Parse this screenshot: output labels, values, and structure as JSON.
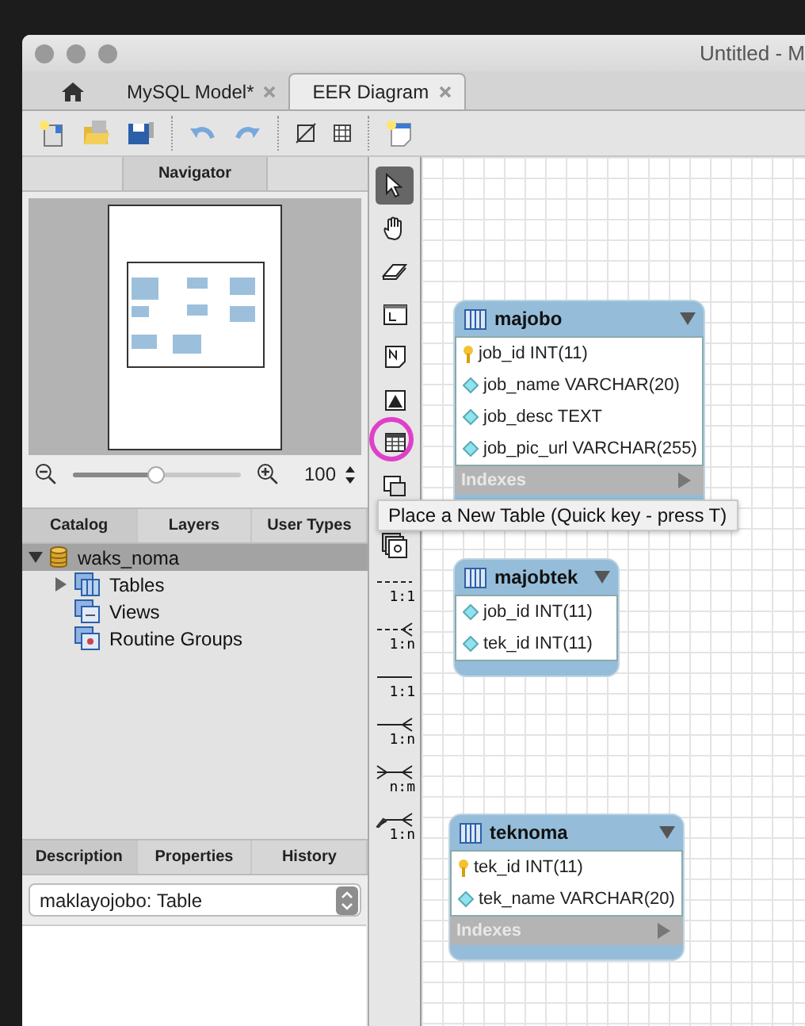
{
  "window": {
    "title": "Untitled - M"
  },
  "tabs": [
    {
      "kind": "home",
      "selected": false
    },
    {
      "kind": "doc",
      "label": "MySQL Model*",
      "selected": false
    },
    {
      "kind": "doc",
      "label": "EER Diagram",
      "selected": true
    }
  ],
  "navigator": {
    "title": "Navigator",
    "zoom": {
      "level": 0.5,
      "value": "100"
    }
  },
  "catalog_tabs": [
    {
      "label": "Catalog",
      "selected": true
    },
    {
      "label": "Layers",
      "selected": false
    },
    {
      "label": "User Types",
      "selected": false
    }
  ],
  "tree": [
    {
      "label": "waks_noma",
      "kind": "schema",
      "expanded": true,
      "selected": true,
      "children": [
        {
          "label": "Tables",
          "kind": "tables",
          "expanded": false,
          "selected": false
        },
        {
          "label": "Views",
          "kind": "views",
          "selected": false
        },
        {
          "label": "Routine Groups",
          "kind": "routines",
          "selected": false
        }
      ]
    }
  ],
  "description_tabs": [
    {
      "label": "Description",
      "selected": true
    },
    {
      "label": "Properties",
      "selected": false
    },
    {
      "label": "History",
      "selected": false
    }
  ],
  "object_selector": {
    "value": "maklayojobo: Table"
  },
  "tools": [
    {
      "kind": "pointer",
      "selected": true,
      "highlighted": false
    },
    {
      "kind": "hand",
      "selected": false,
      "highlighted": false
    },
    {
      "kind": "eraser",
      "selected": false,
      "highlighted": false
    },
    {
      "kind": "layer",
      "selected": false,
      "highlighted": false
    },
    {
      "kind": "note",
      "selected": false,
      "highlighted": false
    },
    {
      "kind": "image",
      "selected": false,
      "highlighted": false
    },
    {
      "kind": "table",
      "selected": false,
      "highlighted": true
    },
    {
      "kind": "view",
      "selected": false,
      "highlighted": false
    },
    {
      "kind": "routine",
      "selected": false,
      "highlighted": false
    },
    {
      "kind": "dashed-one",
      "label": "1:1",
      "selected": false,
      "highlighted": false
    },
    {
      "kind": "dashed-many",
      "label": "1:n",
      "selected": false,
      "highlighted": false
    },
    {
      "kind": "solid-one",
      "label": "1:1",
      "selected": false,
      "highlighted": false
    },
    {
      "kind": "solid-many",
      "label": "1:n",
      "selected": false,
      "highlighted": false
    },
    {
      "kind": "many-many",
      "label": "n:m",
      "selected": false,
      "highlighted": false
    },
    {
      "kind": "picked-many",
      "label": "1:n",
      "selected": false,
      "highlighted": false
    }
  ],
  "tooltip": {
    "text": "Place a New Table (Quick key - press T)"
  },
  "diagram_tables": [
    {
      "name": "majobo",
      "indexes": "Indexes",
      "columns": [
        {
          "text": "job_id INT(11)",
          "kind": "primary"
        },
        {
          "text": "job_name VARCHAR(20)",
          "kind": "regular"
        },
        {
          "text": "job_desc TEXT",
          "kind": "regular"
        },
        {
          "text": "job_pic_url VARCHAR(255)",
          "kind": "regular"
        }
      ]
    },
    {
      "name": "majobtek",
      "columns": [
        {
          "text": "job_id INT(11)",
          "kind": "regular"
        },
        {
          "text": "tek_id INT(11)",
          "kind": "regular"
        }
      ]
    },
    {
      "name": "teknoma",
      "indexes": "Indexes",
      "columns": [
        {
          "text": "tek_id INT(11)",
          "kind": "primary"
        },
        {
          "text": "tek_name VARCHAR(20)",
          "kind": "regular"
        }
      ]
    }
  ]
}
